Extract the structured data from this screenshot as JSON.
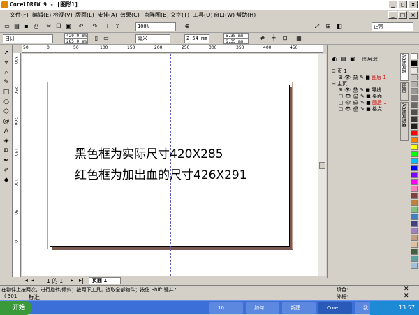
{
  "window": {
    "title": "CorelDRAW 9 - [图形1]",
    "controls": [
      "_",
      "□",
      "×"
    ]
  },
  "menu": [
    "文件(F)",
    "编辑(E)",
    "检视(V)",
    "版面(L)",
    "安排(A)",
    "效果(C)",
    "点阵图(B)",
    "文字(T)",
    "工具(O)",
    "窗口(W)",
    "帮助(H)"
  ],
  "toolbar1": {
    "zoom": "100%",
    "style": "正常"
  },
  "propertybar": {
    "paper": "自订",
    "width": "420.0 mm",
    "height": "285.0 mm",
    "units": "毫米",
    "nudge": "2.54 mm",
    "dup_x": "6.35 mm",
    "dup_y": "6.35 mm"
  },
  "ruler": {
    "h_ticks": [
      "50",
      "0",
      "50",
      "100",
      "150",
      "200",
      "250",
      "300",
      "350",
      "400",
      "450"
    ],
    "v_ticks": [
      "300",
      "250",
      "200",
      "150",
      "100",
      "50",
      "0"
    ]
  },
  "canvas": {
    "line1": "黑色框为实际尺寸420X285",
    "line2": "红色框为加出血的尺寸426X291"
  },
  "docker": {
    "header": "图层:图",
    "tree": [
      {
        "label": "页 1"
      },
      {
        "label": "图层 1",
        "color": "#cc0000"
      },
      {
        "label": "主页"
      },
      {
        "label": "导线"
      },
      {
        "label": "桌面"
      },
      {
        "label": "图层 1",
        "color": "#cc0000"
      },
      {
        "label": "格点"
      }
    ],
    "tabs": [
      "对象管理",
      "图层",
      "对象管理器"
    ]
  },
  "palette": [
    "#ffffff",
    "#000000",
    "#e8e8e8",
    "#c8c8c8",
    "#b0b0b0",
    "#989898",
    "#808080",
    "#686868",
    "#505050",
    "#383838",
    "#202020",
    "#ff0000",
    "#ff8000",
    "#ffff00",
    "#00ff00",
    "#00c0ff",
    "#0000ff",
    "#8000ff",
    "#ff00ff",
    "#ff80c0",
    "#804040",
    "#c08040",
    "#80c080",
    "#4080c0",
    "#404080",
    "#a080c0",
    "#c0a080",
    "#e0c0a0",
    "#406040",
    "#60a0a0",
    "#a0c0e0"
  ],
  "pagebar": {
    "page_of": "1 的 1",
    "page_tab": "页面 1"
  },
  "status": {
    "line1": "在物件上按两次，进行旋转/倾斜；按两下工具，选取全部物件；按住 Shift 键并?..",
    "coords": "( 301",
    "fill_label": "填色:",
    "outline_label": "外框:",
    "standard": "标准"
  },
  "taskbar": {
    "start": "开始",
    "items": [
      "10.",
      "如何...",
      "新建...",
      "Core...",
      "我的..."
    ],
    "clock": "13:57"
  }
}
